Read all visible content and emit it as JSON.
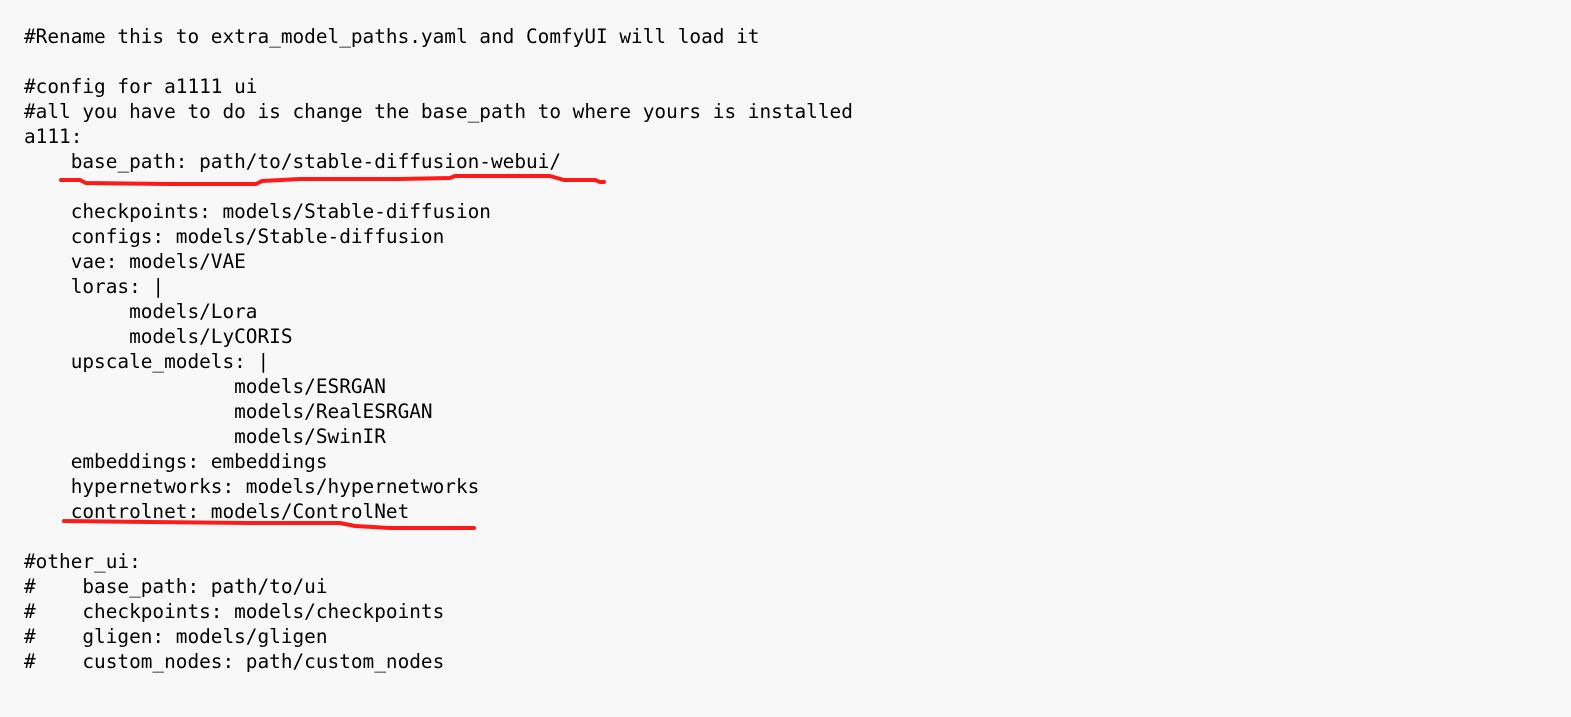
{
  "document": {
    "lines": [
      "#Rename this to extra_model_paths.yaml and ComfyUI will load it",
      "",
      "#config for a1111 ui",
      "#all you have to do is change the base_path to where yours is installed",
      "a111:",
      "    base_path: path/to/stable-diffusion-webui/",
      "",
      "    checkpoints: models/Stable-diffusion",
      "    configs: models/Stable-diffusion",
      "    vae: models/VAE",
      "    loras: |",
      "         models/Lora",
      "         models/LyCORIS",
      "    upscale_models: |",
      "                  models/ESRGAN",
      "                  models/RealESRGAN",
      "                  models/SwinIR",
      "    embeddings: embeddings",
      "    hypernetworks: models/hypernetworks",
      "    controlnet: models/ControlNet",
      "",
      "#other_ui:",
      "#    base_path: path/to/ui",
      "#    checkpoints: models/checkpoints",
      "#    gligen: models/gligen",
      "#    custom_nodes: path/custom_nodes"
    ]
  },
  "annotations": {
    "color": "#ff1a1a",
    "underlined_lines": [
      "    base_path: path/to/stable-diffusion-webui/",
      "    controlnet: models/ControlNet"
    ]
  }
}
